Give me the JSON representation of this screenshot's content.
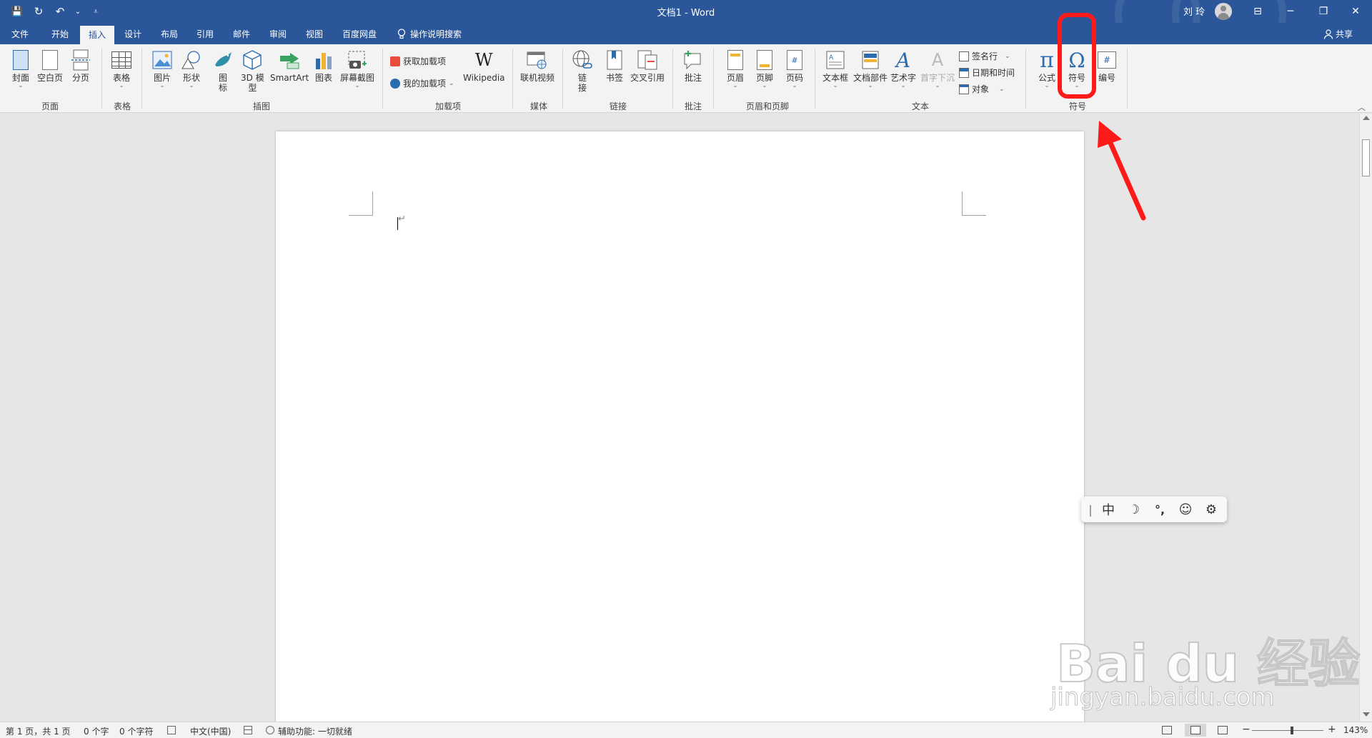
{
  "window": {
    "doc_title": "文档1 - Word",
    "user_name": "刘 玲",
    "minimize_glyph": "─",
    "restore_glyph": "❐",
    "close_glyph": "✕",
    "ribbon_display_glyph": "⊟"
  },
  "qat": {
    "save_glyph": "💾",
    "autosave_glyph": "↻",
    "undo_glyph": "↶",
    "undo_dd": "⌄",
    "customize_glyph": "⩡"
  },
  "tabs": [
    "文件",
    "开始",
    "插入",
    "设计",
    "布局",
    "引用",
    "邮件",
    "审阅",
    "视图",
    "百度网盘"
  ],
  "active_tab": "插入",
  "tell_me": "操作说明搜索",
  "share": "共享",
  "ribbon": {
    "pages": {
      "label": "页面",
      "cover": "封面",
      "blank": "空白页",
      "break": "分页"
    },
    "tables": {
      "label": "表格",
      "table": "表格"
    },
    "illustrations": {
      "label": "插图",
      "pictures": "图片",
      "shapes": "形状",
      "icons_1": "图",
      "icons_2": "标",
      "model3d_1": "3D 模",
      "model3d_2": "型",
      "smartart": "SmartArt",
      "chart": "图表",
      "screenshot": "屏幕截图"
    },
    "addins": {
      "label": "加载项",
      "get": "获取加载项",
      "my": "我的加载项",
      "wikipedia": "Wikipedia",
      "wiki_glyph": "W"
    },
    "media": {
      "label": "媒体",
      "online_video": "联机视频"
    },
    "links": {
      "label": "链接",
      "link_1": "链",
      "link_2": "接",
      "bookmark": "书签",
      "cross_ref": "交叉引用"
    },
    "comments": {
      "label": "批注",
      "comment": "批注"
    },
    "header_footer": {
      "label": "页眉和页脚",
      "header": "页眉",
      "footer": "页脚",
      "page_number": "页码",
      "hash_glyph": "#"
    },
    "text": {
      "label": "文本",
      "textbox": "文本框",
      "quick_parts": "文档部件",
      "wordart": "艺术字",
      "dropcap": "首字下沉",
      "signature": "签名行",
      "datetime": "日期和时间",
      "object": "对象",
      "wordart_glyph": "A",
      "dropcap_glyph": "A"
    },
    "symbols": {
      "label": "符号",
      "equation": "公式",
      "symbol": "符号",
      "number": "编号",
      "pi_glyph": "π",
      "omega_glyph": "Ω",
      "hash_glyph": "#"
    },
    "dropdown_glyph": "⌄",
    "collapse_glyph": "︿"
  },
  "document": {
    "paragraph_mark": "↵"
  },
  "ime": {
    "bar": "|",
    "lang": "中",
    "moon": "☽",
    "punct": "°,",
    "emoji": "☺",
    "settings": "⚙"
  },
  "status": {
    "page": "第 1 页，共 1 页",
    "words": "0 个字",
    "chars": "0 个字符",
    "language": "中文(中国)",
    "accessibility": "辅助功能: 一切就绪",
    "zoom": "143%",
    "minus": "−",
    "plus": "+"
  },
  "watermark": {
    "brand": "Bai du 经验",
    "url": "jingyan.baidu.com"
  },
  "colors": {
    "title_blue": "#2b579a",
    "ribbon_bg": "#f3f3f3",
    "annotation_red": "#ff1a1a"
  }
}
